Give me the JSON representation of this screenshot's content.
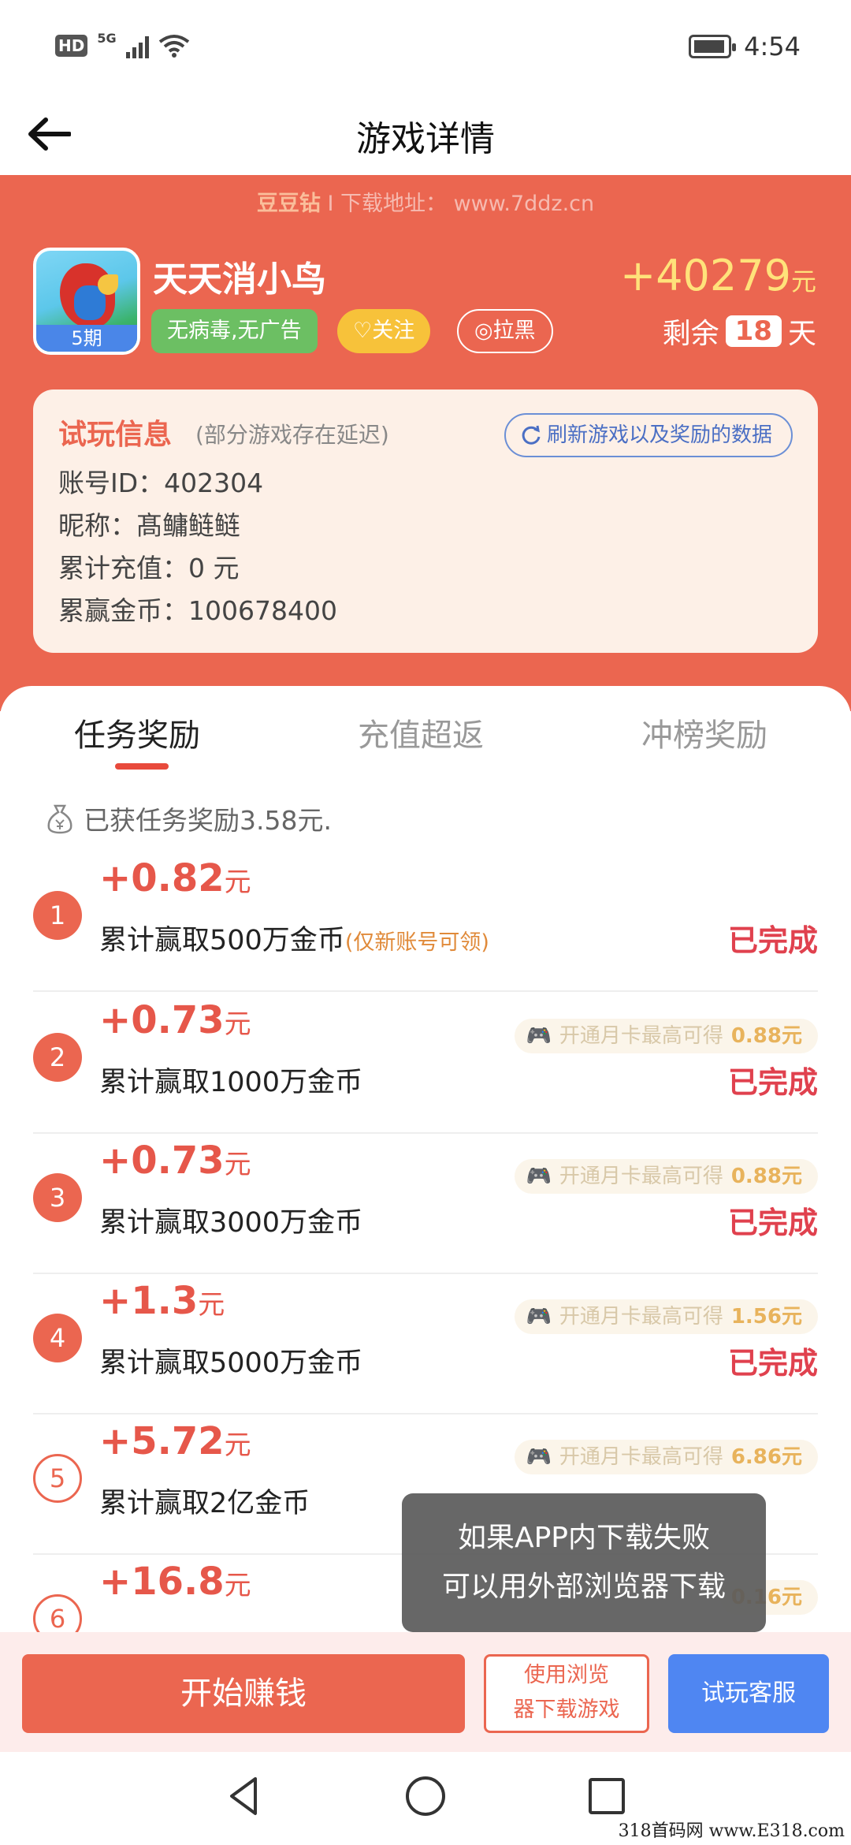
{
  "status_bar": {
    "hd": "HD",
    "network": "5G",
    "time": "4:54"
  },
  "header": {
    "back_icon": "arrow-left-icon",
    "title": "游戏详情"
  },
  "watermark": {
    "brand": "豆豆钻",
    "text": "I 下载地址： www.7ddz.cn"
  },
  "game": {
    "name": "天天消小鸟",
    "period": "5期",
    "tag_safe": "无病毒,无广告",
    "follow_label": "关注",
    "block_label": "拉黑",
    "total_reward": "+40279",
    "total_unit": "元",
    "remain_prefix": "剩余",
    "remain_days": "18",
    "remain_suffix": "天"
  },
  "trial_info": {
    "title": "试玩信息",
    "subtitle": "(部分游戏存在延迟)",
    "refresh_label": "刷新游戏以及奖励的数据",
    "account_id": "账号ID：402304",
    "nickname": "昵称：髙鳙鲢鲢",
    "recharge": "累计充值：0 元",
    "coins": "累赢金币：100678400"
  },
  "tabs": [
    {
      "label": "任务奖励",
      "active": true
    },
    {
      "label": "充值超返",
      "active": false
    },
    {
      "label": "冲榜奖励",
      "active": false
    }
  ],
  "earned_text": "已获任务奖励3.58元.",
  "tasks": [
    {
      "num": "1",
      "amount": "+0.82",
      "unit": "元",
      "desc": "累计赢取500万金币",
      "note": "(仅新账号可领)",
      "promo": "",
      "promo_value": "",
      "status": "已完成"
    },
    {
      "num": "2",
      "amount": "+0.73",
      "unit": "元",
      "desc": "累计赢取1000万金币",
      "note": "",
      "promo": "开通月卡最高可得",
      "promo_value": "0.88元",
      "status": "已完成"
    },
    {
      "num": "3",
      "amount": "+0.73",
      "unit": "元",
      "desc": "累计赢取3000万金币",
      "note": "",
      "promo": "开通月卡最高可得",
      "promo_value": "0.88元",
      "status": "已完成"
    },
    {
      "num": "4",
      "amount": "+1.3",
      "unit": "元",
      "desc": "累计赢取5000万金币",
      "note": "",
      "promo": "开通月卡最高可得",
      "promo_value": "1.56元",
      "status": "已完成"
    },
    {
      "num": "5",
      "amount": "+5.72",
      "unit": "元",
      "desc": "累计赢取2亿金币",
      "note": "",
      "promo": "开通月卡最高可得",
      "promo_value": "6.86元",
      "status": ""
    },
    {
      "num": "6",
      "amount": "+16.8",
      "unit": "元",
      "desc": "",
      "note": "",
      "promo": "",
      "promo_value": "0.16元",
      "status": ""
    }
  ],
  "toast": {
    "line1": "如果APP内下载失败",
    "line2": "可以用外部浏览器下载"
  },
  "actions": {
    "earn": "开始赚钱",
    "browser_line1": "使用浏览",
    "browser_line2": "器下载游戏",
    "service": "试玩客服"
  },
  "footer_watermark": "318首码网 www.E318.com",
  "colors": {
    "header_red": "#eb6650",
    "reward_yellow": "#ffe27a",
    "status_red": "#e0414e",
    "service_blue": "#4f86f2"
  }
}
